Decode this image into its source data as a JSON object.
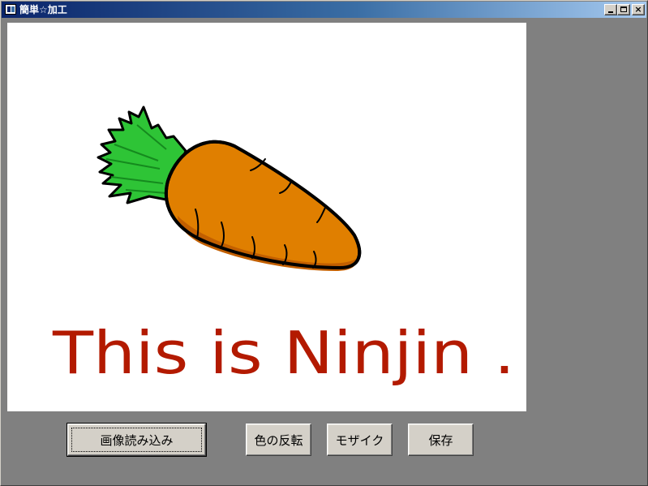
{
  "window": {
    "title": "簡単☆加工",
    "minimize_symbol": "_",
    "maximize_symbol": "□",
    "close_symbol": "×"
  },
  "canvas": {
    "image_text": "This is Ninjin ."
  },
  "buttons": {
    "load_image": "画像読み込み",
    "invert_colors": "色の反転",
    "mosaic": "モザイク",
    "save": "保存"
  },
  "colors": {
    "carrot_orange": "#e07f00",
    "carrot_shadow": "#c25f00",
    "leaf_green": "#2ec436",
    "text_red": "#b31a00"
  }
}
